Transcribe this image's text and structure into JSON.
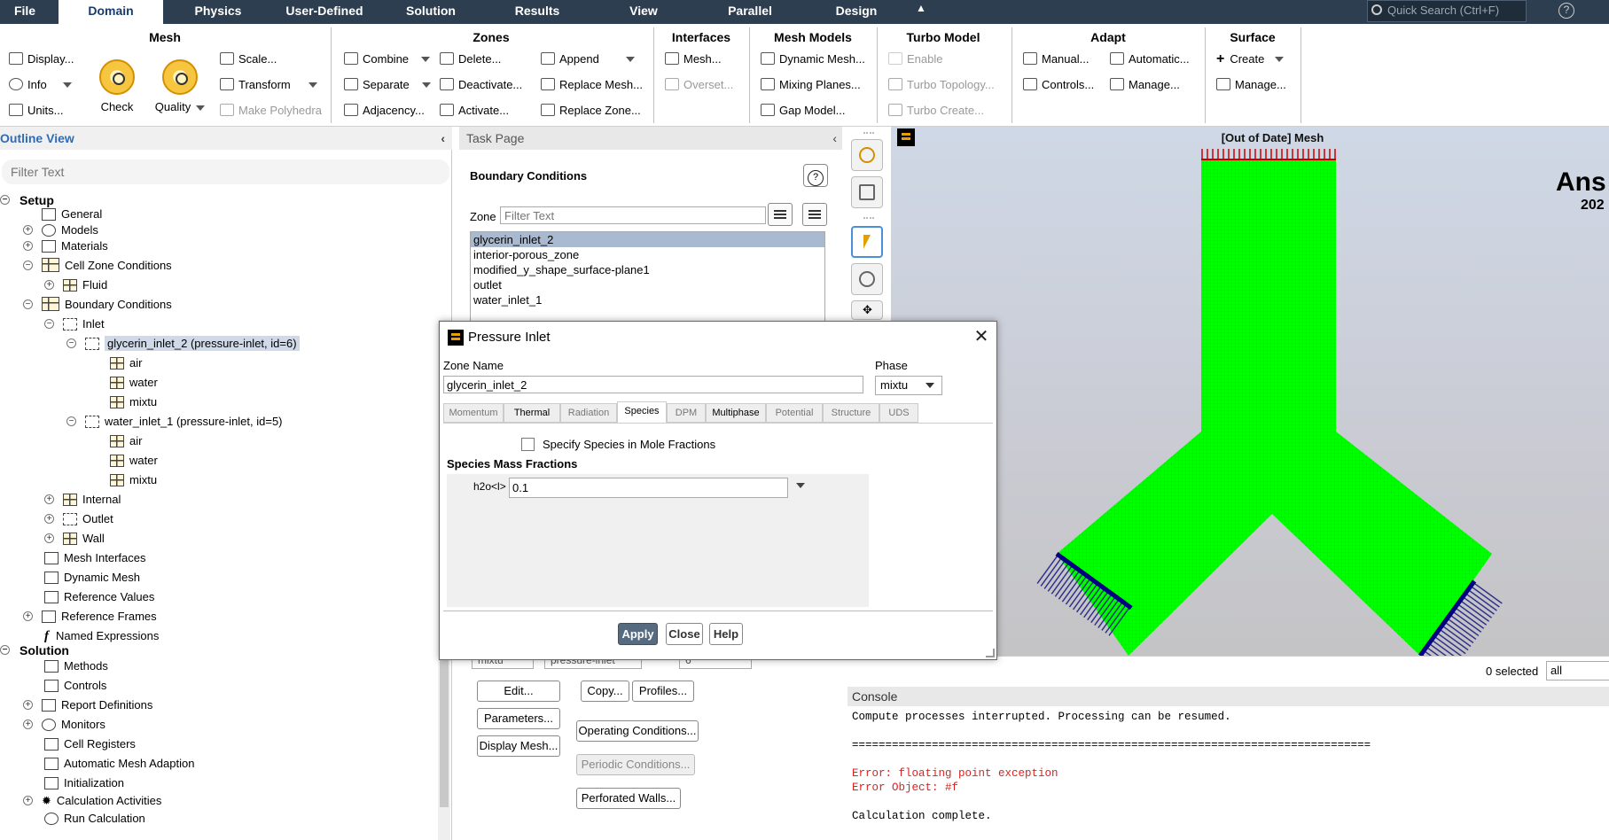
{
  "menubar": {
    "tabs": [
      "File",
      "Domain",
      "Physics",
      "User-Defined",
      "Solution",
      "Results",
      "View",
      "Parallel",
      "Design"
    ],
    "active_tab": "Domain",
    "search_placeholder": "Quick Search (Ctrl+F)"
  },
  "ribbon": {
    "mesh": {
      "title": "Mesh",
      "display": "Display...",
      "info": "Info",
      "units": "Units...",
      "check": "Check",
      "quality": "Quality",
      "scale": "Scale...",
      "transform": "Transform",
      "make_polyhedra": "Make Polyhedra"
    },
    "zones": {
      "title": "Zones",
      "combine": "Combine",
      "separate": "Separate",
      "adjacency": "Adjacency...",
      "delete": "Delete...",
      "deactivate": "Deactivate...",
      "activate": "Activate...",
      "append": "Append",
      "replace_mesh": "Replace Mesh...",
      "replace_zone": "Replace Zone..."
    },
    "interfaces": {
      "title": "Interfaces",
      "mesh": "Mesh...",
      "overset": "Overset..."
    },
    "mesh_models": {
      "title": "Mesh Models",
      "dynamic_mesh": "Dynamic Mesh...",
      "mixing_planes": "Mixing Planes...",
      "gap_model": "Gap Model..."
    },
    "turbo_model": {
      "title": "Turbo Model",
      "enable": "Enable",
      "turbo_topology": "Turbo Topology...",
      "turbo_create": "Turbo Create..."
    },
    "adapt": {
      "title": "Adapt",
      "manual": "Manual...",
      "controls": "Controls...",
      "automatic": "Automatic...",
      "manage": "Manage..."
    },
    "surface": {
      "title": "Surface",
      "create": "Create",
      "manage": "Manage..."
    }
  },
  "outline": {
    "title": "Outline View",
    "filter_placeholder": "Filter Text",
    "tree": {
      "setup": "Setup",
      "general": "General",
      "models": "Models",
      "materials": "Materials",
      "cell_zone": "Cell Zone Conditions",
      "fluid": "Fluid",
      "boundary": "Boundary Conditions",
      "inlet": "Inlet",
      "glycerin": "glycerin_inlet_2 (pressure-inlet, id=6)",
      "air": "air",
      "water": "water",
      "mixtu": "mixtu",
      "water_inlet": "water_inlet_1 (pressure-inlet, id=5)",
      "internal": "Internal",
      "outlet": "Outlet",
      "wall": "Wall",
      "mesh_interfaces": "Mesh Interfaces",
      "dynamic_mesh": "Dynamic Mesh",
      "reference_values": "Reference Values",
      "reference_frames": "Reference Frames",
      "named_expressions": "Named Expressions",
      "solution": "Solution",
      "methods": "Methods",
      "controls": "Controls",
      "report_definitions": "Report Definitions",
      "monitors": "Monitors",
      "cell_registers": "Cell Registers",
      "auto_mesh_adaption": "Automatic Mesh Adaption",
      "initialization": "Initialization",
      "calc_activities": "Calculation Activities",
      "run_calculation": "Run Calculation"
    }
  },
  "taskpage": {
    "header": "Task Page",
    "title": "Boundary Conditions",
    "zone_label": "Zone",
    "zone_filter_placeholder": "Filter Text",
    "zones": [
      "glycerin_inlet_2",
      "interior-porous_zone",
      "modified_y_shape_surface-plane1",
      "outlet",
      "water_inlet_1"
    ],
    "selected_zone": "glycerin_inlet_2",
    "hidden_row": {
      "phase": "mixtu",
      "type": "pressure-inlet",
      "id": "6"
    },
    "buttons": {
      "edit": "Edit...",
      "copy": "Copy...",
      "profiles": "Profiles...",
      "parameters": "Parameters...",
      "operating": "Operating Conditions...",
      "display_mesh": "Display Mesh...",
      "periodic": "Periodic Conditions...",
      "perforated": "Perforated Walls..."
    }
  },
  "viewport": {
    "title": "[Out of Date] Mesh",
    "logo": "Ans",
    "year": "202"
  },
  "selection": {
    "count": "0 selected",
    "filter": "all"
  },
  "console": {
    "header": "Console",
    "line1": "Compute processes interrupted. Processing can be resumed.",
    "divider": "==============================================================================",
    "err1": "Error: floating point exception",
    "err2": "Error Object: #f",
    "line_last": "Calculation complete."
  },
  "dialog": {
    "title": "Pressure Inlet",
    "zone_name_label": "Zone Name",
    "zone_name": "glycerin_inlet_2",
    "phase_label": "Phase",
    "phase": "mixtu",
    "tabs": [
      "Momentum",
      "Thermal",
      "Radiation",
      "Species",
      "DPM",
      "Multiphase",
      "Potential",
      "Structure",
      "UDS"
    ],
    "active_tab": "Species",
    "mole_fractions_label": "Specify Species in Mole Fractions",
    "mass_fractions_title": "Species Mass Fractions",
    "h2o_label": "h2o<l>",
    "h2o_value": "0.1",
    "apply": "Apply",
    "close": "Close",
    "help": "Help"
  },
  "colors": {
    "menubar": "#2c3e50",
    "mesh_green": "#00ff00",
    "inlet_marks": "#cc0000",
    "outlet_marks": "#000080",
    "error_text": "#e02020"
  }
}
